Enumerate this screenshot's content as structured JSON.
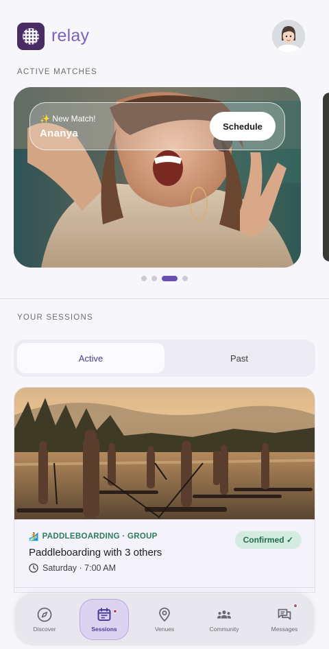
{
  "app": {
    "name": "relay"
  },
  "sections": {
    "active_matches_label": "ACTIVE MATCHES",
    "your_sessions_label": "YOUR SESSIONS"
  },
  "match_card": {
    "kicker": "✨ New Match!",
    "name": "Ananya",
    "schedule_label": "Schedule",
    "carousel_page": 3,
    "carousel_total": 4
  },
  "tabs": {
    "active_label": "Active",
    "past_label": "Past",
    "selected": "Active"
  },
  "session": {
    "tag_icon": "🏄",
    "tag": "PADDLEBOARDING · GROUP",
    "title": "Paddleboarding with 3 others",
    "time": "Saturday · 7:00 AM",
    "status": "Confirmed ✓"
  },
  "nav": {
    "items": [
      {
        "label": "Discover",
        "icon": "compass-icon"
      },
      {
        "label": "Sessions",
        "icon": "calendar-icon",
        "active": true,
        "badge": true
      },
      {
        "label": "Venues",
        "icon": "map-pin-icon"
      },
      {
        "label": "Community",
        "icon": "people-icon"
      },
      {
        "label": "Messages",
        "icon": "chat-icon",
        "badge": true
      }
    ]
  },
  "colors": {
    "brand": "#7d5fc0",
    "brand_dark": "#4a2b63",
    "confirmed_bg": "#d3ebe1",
    "confirmed_text": "#1f6d4c",
    "tag_green": "#2c7c5a",
    "active_dot": "#6a4fb0"
  }
}
